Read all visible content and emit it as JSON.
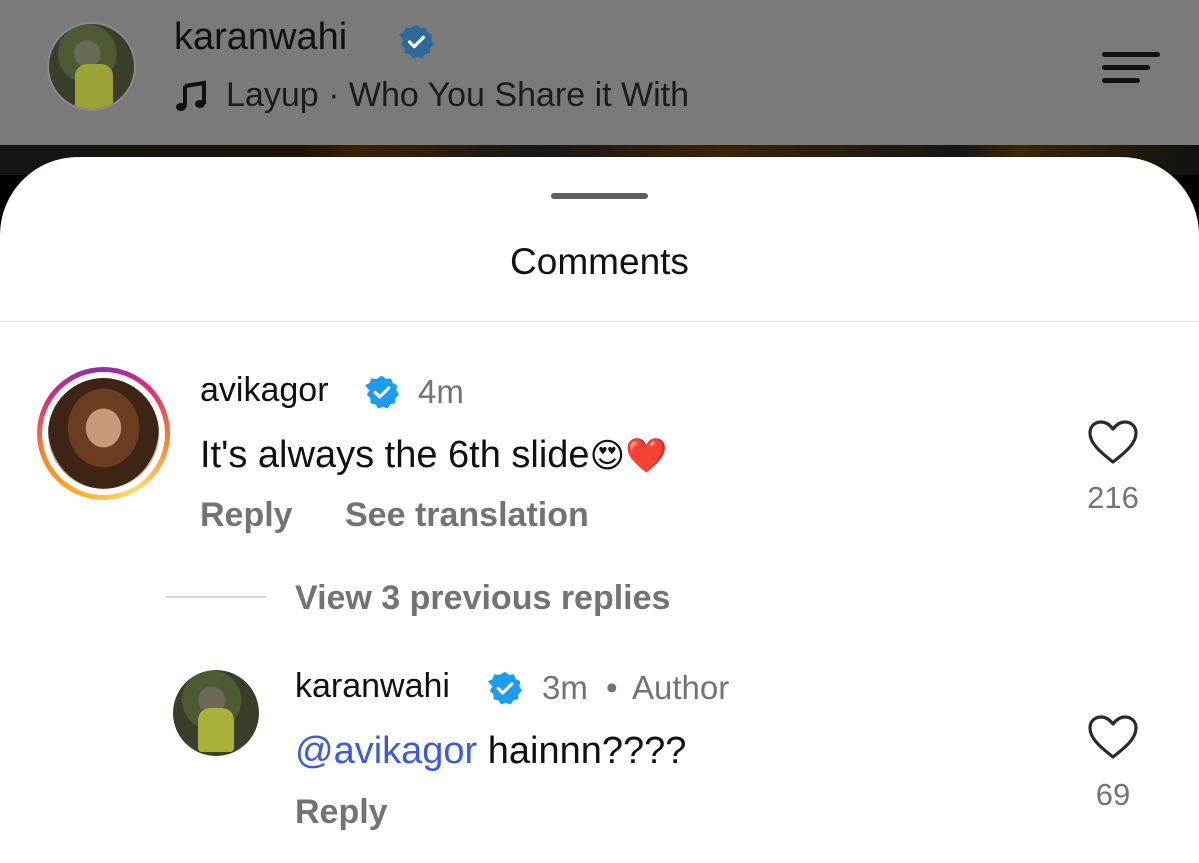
{
  "header": {
    "username": "karanwahi",
    "song": "Layup · Who You Share it With",
    "icons": {
      "verified": "verified-badge-icon",
      "music": "music-note-icon",
      "menu": "menu-icon"
    }
  },
  "sheet": {
    "title": "Comments"
  },
  "comments": [
    {
      "username": "avikagor",
      "time": "4m",
      "text": "It's always the 6th slide",
      "emojis": "😍❤️",
      "reply_label": "Reply",
      "translate_label": "See translation",
      "likes": "216"
    }
  ],
  "view_replies": "View 3 previous replies",
  "reply": {
    "username": "karanwahi",
    "time": "3m",
    "separator": "•",
    "role": "Author",
    "mention": "@avikagor",
    "text": " hainnn????",
    "reply_label": "Reply",
    "likes": "69"
  },
  "colors": {
    "verified": "#1d9bf0",
    "mention": "#3b5bd9",
    "secondary_text": "#737373"
  }
}
